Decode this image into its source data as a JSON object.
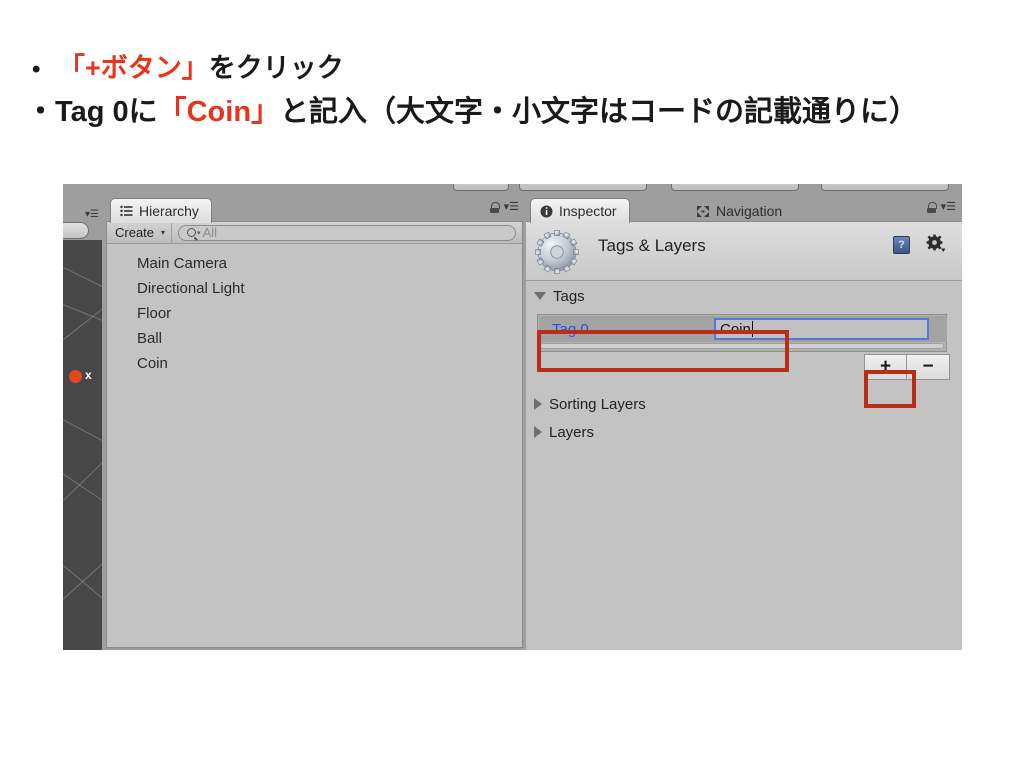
{
  "slide": {
    "bullets": [
      {
        "marker": "•",
        "segments": [
          {
            "text": "「+ボタン」",
            "color": "red"
          },
          {
            "text": "をクリック",
            "color": "black"
          }
        ]
      },
      {
        "marker": "・",
        "segments": [
          {
            "text": "Tag 0に",
            "color": "black"
          },
          {
            "text": "「Coin」",
            "color": "red"
          },
          {
            "text": "と記入（大文字・小文字はコードの記載通りに）",
            "color": "black"
          }
        ]
      }
    ],
    "bullet1_marker": "•",
    "bullet1_red": "「+ボタン」",
    "bullet1_black": "をクリック",
    "bullet2_marker": "・",
    "bullet2_pre": "Tag 0に",
    "bullet2_red": "「Coin」",
    "bullet2_post": "と記入（大文字・小文字はコードの記載通りに）",
    "accent_red": "#e8341c",
    "annotation_red": "#ba2d18"
  },
  "unity": {
    "scene_view": {
      "gizmo_axis_label": "x"
    },
    "hierarchy": {
      "tab_label": "Hierarchy",
      "tab_icon": "hierarchy-list-icon",
      "lock_icon": "lock-icon",
      "menu_icon": "panel-menu-icon",
      "create_button": "Create",
      "create_caret": "▾",
      "search_icon": "search-icon",
      "search_caret": "▾",
      "search_placeholder": "All",
      "search_value": "",
      "items": [
        "Main Camera",
        "Directional Light",
        "Floor",
        "Ball",
        "Coin"
      ]
    },
    "inspector": {
      "tabs": [
        {
          "label": "Inspector",
          "icon": "info-circle-icon",
          "active": true
        },
        {
          "label": "Navigation",
          "icon": "navigation-arrows-icon",
          "active": false
        }
      ],
      "lock_icon": "lock-icon",
      "menu_icon": "panel-menu-icon",
      "asset_icon": "settings-gear-asset-icon",
      "title": "Tags & Layers",
      "help_icon": "help-book-icon",
      "help_glyph": "?",
      "gear_icon": "gear-dropdown-icon",
      "sections": {
        "tags": {
          "label": "Tags",
          "expanded": true,
          "triangle": "down"
        },
        "sorting_layers": {
          "label": "Sorting Layers",
          "expanded": false,
          "triangle": "right"
        },
        "layers": {
          "label": "Layers",
          "expanded": false,
          "triangle": "right"
        }
      },
      "tag_rows": [
        {
          "label": "Tag 0",
          "value": "Coin",
          "focused": true
        }
      ],
      "add_button": "+",
      "remove_button": "−"
    }
  }
}
